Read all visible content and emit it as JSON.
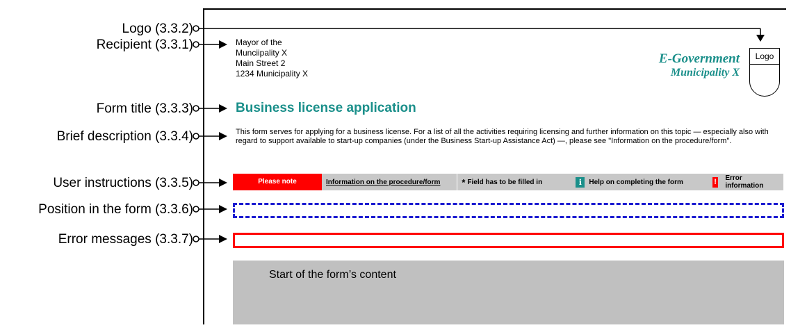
{
  "callouts": [
    {
      "id": "logo",
      "label": "Logo (3.3.2)"
    },
    {
      "id": "recipient",
      "label": "Recipient  (3.3.1)"
    },
    {
      "id": "form_title",
      "label": "Form title  (3.3.3)"
    },
    {
      "id": "brief_description",
      "label": "Brief description (3.3.4)"
    },
    {
      "id": "user_instructions",
      "label": "User instructions (3.3.5)"
    },
    {
      "id": "position_in_form",
      "label": "Position in the form (3.3.6)"
    },
    {
      "id": "error_messages",
      "label": "Error messages (3.3.7)"
    }
  ],
  "recipient": {
    "lines": [
      "Mayor of the",
      "Munciipality X",
      "Main Street 2",
      "1234 Municipality X"
    ]
  },
  "branding": {
    "line1": "E-Government",
    "line2": "Municipality X",
    "logo_label": "Logo",
    "color": "#1a8f8a"
  },
  "form": {
    "title": "Business license application",
    "description": "This form serves for applying for a business license. For a list of all the activities requiring licensing and further information on this topic — especially also with regard to support available to start-up companies (under the Business Start-up Assistance Act) —, please see \"Information on the procedure/form\".",
    "content_start": "Start of the form’s content"
  },
  "instructions": {
    "please_note": "Please note",
    "procedure_link": "Information on the procedure/form",
    "required_marker": "*",
    "required_text": "Field has to be filled in",
    "help_icon": "i",
    "help_text": "Help on completing the form",
    "error_icon": "!",
    "error_text": "Error information"
  },
  "colors": {
    "accent": "#1a8f8a",
    "alert": "#ff0000",
    "position_border": "#1a1ad0",
    "bar_bg": "#c8c8c8",
    "content_bg": "#c0c0c0"
  }
}
